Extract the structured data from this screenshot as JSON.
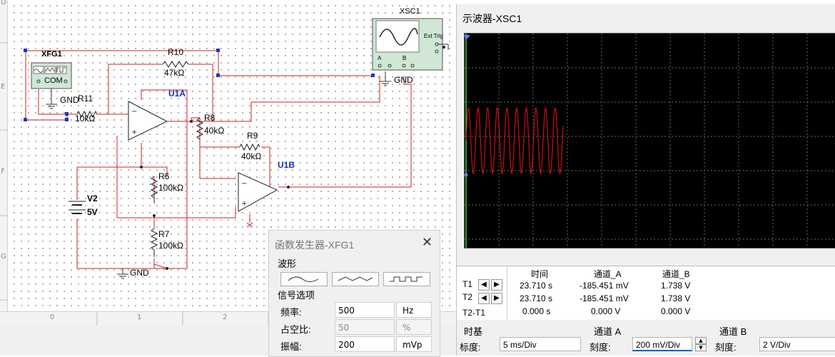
{
  "schematic": {
    "xfg_label": "XFG1",
    "xfg_com": "COM",
    "xsc_label": "XSC1",
    "xsc_ext_trig": "Ext Trig",
    "xsc_a": "A",
    "xsc_b": "B",
    "r10_name": "R10",
    "r10_value": "47kΩ",
    "r11_name": "R11",
    "r11_value": "10kΩ",
    "r8_name": "R8",
    "r8_value": "40kΩ",
    "r9_name": "R9",
    "r9_value": "40kΩ",
    "r6_name": "R6",
    "r6_value": "100kΩ",
    "r7_name": "R7",
    "r7_value": "100kΩ",
    "u1a": "U1A",
    "u1b": "U1B",
    "v2_name": "V2",
    "v2_value": "5V",
    "gnd1": "GND",
    "gnd2": "GND",
    "gnd3": "GND",
    "ruler_left": [
      "D",
      "E",
      "F",
      "G"
    ],
    "ruler_bottom": [
      "0",
      "1",
      "2"
    ]
  },
  "oscilloscope": {
    "title": "示波器-XSC1",
    "col_time": "时间",
    "col_a": "通道_A",
    "col_b": "通道_B",
    "rows": [
      {
        "label": "T1",
        "time": "23.710 s",
        "a": "-185.451 mV",
        "b": "1.738 V"
      },
      {
        "label": "T2",
        "time": "23.710 s",
        "a": "-185.451 mV",
        "b": "1.738 V"
      },
      {
        "label": "T2-T1",
        "time": "0.000 s",
        "a": "0.000 V",
        "b": "0.000 V"
      }
    ],
    "timebase_title": "时基",
    "timebase_scale_label": "标度:",
    "timebase_scale": "5 ms/Div",
    "channel_a_title": "通道 A",
    "channel_a_scale_label": "刻度:",
    "channel_a_scale": "200 mV/Div",
    "channel_b_title": "通道 B",
    "channel_b_scale_label": "刻度:",
    "channel_b_scale": "2  V/Div",
    "trace_color": "#cc1111"
  },
  "function_generator": {
    "title": "函数发生器-XFG1",
    "close": "✕",
    "waveform_label": "波形",
    "signal_options_label": "信号选项",
    "frequency_label": "频率:",
    "frequency_value": "500",
    "frequency_unit": "Hz",
    "duty_label": "占空比:",
    "duty_value": "50",
    "duty_unit": "%",
    "amplitude_label": "振幅:",
    "amplitude_value": "200",
    "amplitude_unit": "mVp"
  },
  "colors": {
    "wire": "#cc2222",
    "bluewire": "#2233cc",
    "label_blue": "#1133cc"
  }
}
